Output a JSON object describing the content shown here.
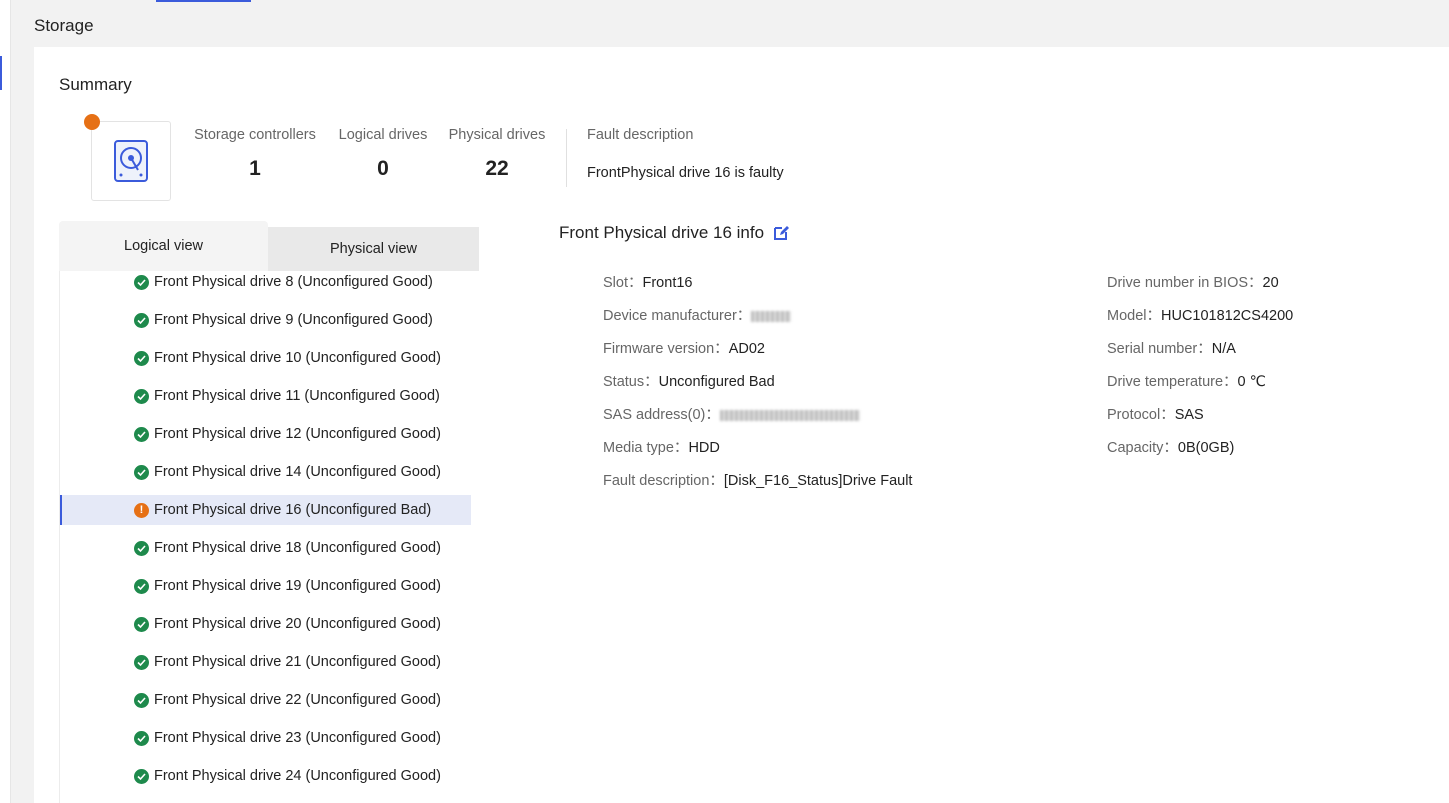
{
  "page": {
    "title": "Storage"
  },
  "summary": {
    "title": "Summary",
    "storage_controllers": {
      "label": "Storage controllers",
      "value": "1"
    },
    "logical_drives": {
      "label": "Logical drives",
      "value": "0"
    },
    "physical_drives": {
      "label": "Physical drives",
      "value": "22"
    },
    "fault": {
      "label": "Fault description",
      "text": "FrontPhysical drive 16 is faulty"
    },
    "status_color": "#e67015"
  },
  "tabs": {
    "logical": "Logical view",
    "physical": "Physical view"
  },
  "drives": [
    {
      "label": "Front Physical drive 8 (Unconfigured Good)",
      "status": "ok"
    },
    {
      "label": "Front Physical drive 9 (Unconfigured Good)",
      "status": "ok"
    },
    {
      "label": "Front Physical drive 10 (Unconfigured Good)",
      "status": "ok"
    },
    {
      "label": "Front Physical drive 11 (Unconfigured Good)",
      "status": "ok"
    },
    {
      "label": "Front Physical drive 12 (Unconfigured Good)",
      "status": "ok"
    },
    {
      "label": "Front Physical drive 14 (Unconfigured Good)",
      "status": "ok"
    },
    {
      "label": "Front Physical drive 16 (Unconfigured Bad)",
      "status": "bad"
    },
    {
      "label": "Front Physical drive 18 (Unconfigured Good)",
      "status": "ok"
    },
    {
      "label": "Front Physical drive 19 (Unconfigured Good)",
      "status": "ok"
    },
    {
      "label": "Front Physical drive 20 (Unconfigured Good)",
      "status": "ok"
    },
    {
      "label": "Front Physical drive 21 (Unconfigured Good)",
      "status": "ok"
    },
    {
      "label": "Front Physical drive 22 (Unconfigured Good)",
      "status": "ok"
    },
    {
      "label": "Front Physical drive 23 (Unconfigured Good)",
      "status": "ok"
    },
    {
      "label": "Front Physical drive 24 (Unconfigured Good)",
      "status": "ok"
    }
  ],
  "info": {
    "title": "Front Physical drive 16 info",
    "left": [
      {
        "key": "Slot：",
        "value": "Front16"
      },
      {
        "key": "Device manufacturer：",
        "value": "",
        "blurred": true
      },
      {
        "key": "Firmware version：",
        "value": "AD02"
      },
      {
        "key": "Status：",
        "value": "Unconfigured Bad"
      },
      {
        "key": "SAS address(0)：",
        "value": "",
        "blurred": true
      },
      {
        "key": "Media type：",
        "value": "HDD"
      },
      {
        "key": "Fault description：",
        "value": "[Disk_F16_Status]Drive Fault"
      }
    ],
    "right": [
      {
        "key": "Drive number in BIOS：",
        "value": "20"
      },
      {
        "key": "Model：",
        "value": "HUC101812CS4200"
      },
      {
        "key": "Serial number：",
        "value": "N/A"
      },
      {
        "key": "Drive temperature：",
        "value": "0 ℃"
      },
      {
        "key": "Protocol：",
        "value": "SAS"
      },
      {
        "key": "Capacity：",
        "value": "0B(0GB)"
      }
    ]
  },
  "colors": {
    "ok": "#1e8a4c",
    "bad": "#e67015",
    "accent": "#3b5bdb"
  }
}
